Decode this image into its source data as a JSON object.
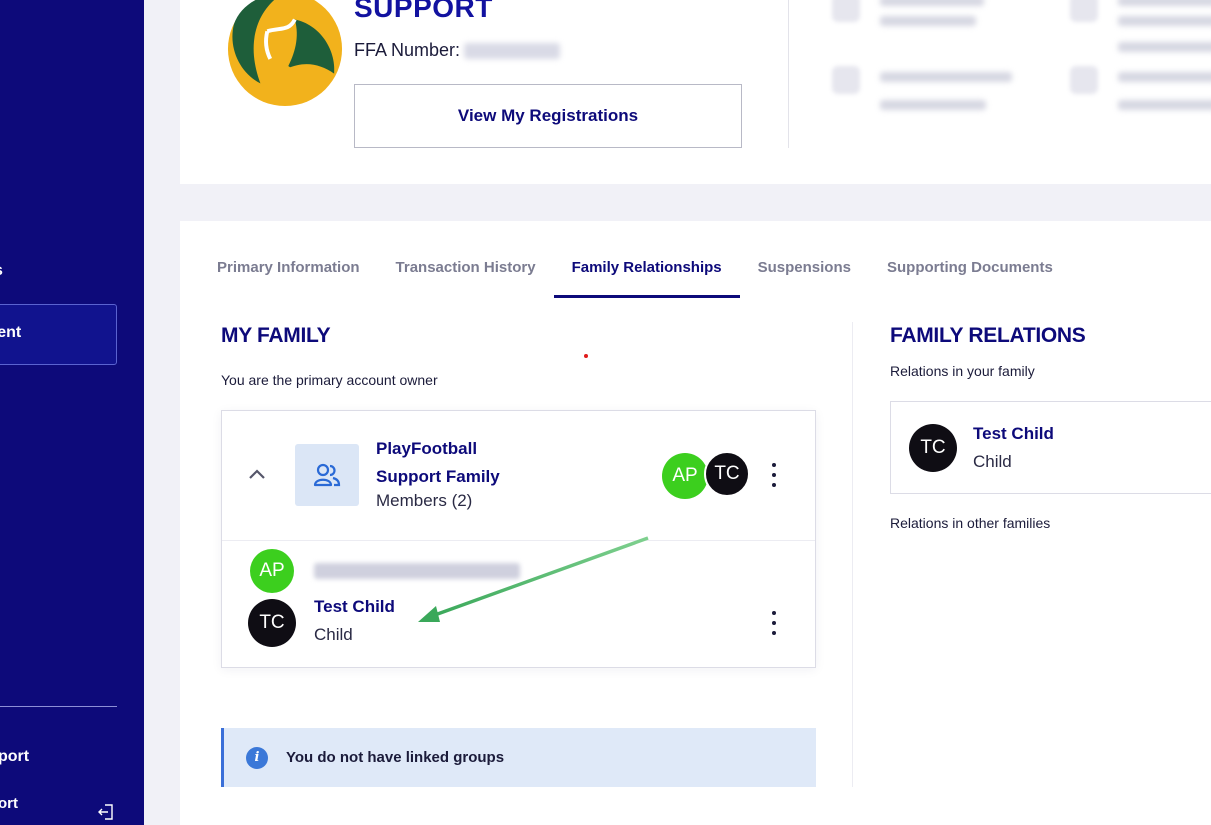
{
  "sidebar": {
    "items": [
      {
        "label": "s"
      },
      {
        "label": "ment"
      },
      {
        "label": "port"
      },
      {
        "label": "ort"
      }
    ]
  },
  "header": {
    "org_title": "SUPPORT",
    "ffa_label": "FFA Number:",
    "view_registrations": "View My Registrations"
  },
  "tabs": [
    {
      "label": "Primary Information"
    },
    {
      "label": "Transaction History"
    },
    {
      "label": "Family Relationships"
    },
    {
      "label": "Suspensions"
    },
    {
      "label": "Supporting Documents"
    }
  ],
  "my_family": {
    "title": "MY FAMILY",
    "subtitle": "You are the primary account owner",
    "family": {
      "name": "PlayFootball Support Family",
      "members_label": "Members (2)",
      "avatars": [
        "AP",
        "TC"
      ]
    },
    "members": [
      {
        "initials": "AP"
      },
      {
        "initials": "TC",
        "name": "Test Child",
        "role": "Child"
      }
    ],
    "linked_groups_notice": "You do not have linked groups"
  },
  "family_relations": {
    "title": "FAMILY RELATIONS",
    "subtitle": "Relations in your family",
    "relation": {
      "initials": "TC",
      "name": "Test Child",
      "role": "Child"
    },
    "other_families_label": "Relations in other families"
  },
  "colors": {
    "brand_navy": "#0d0a7a",
    "avatar_green": "#3ccf1e",
    "annotation_arrow": "#3aa85a"
  }
}
